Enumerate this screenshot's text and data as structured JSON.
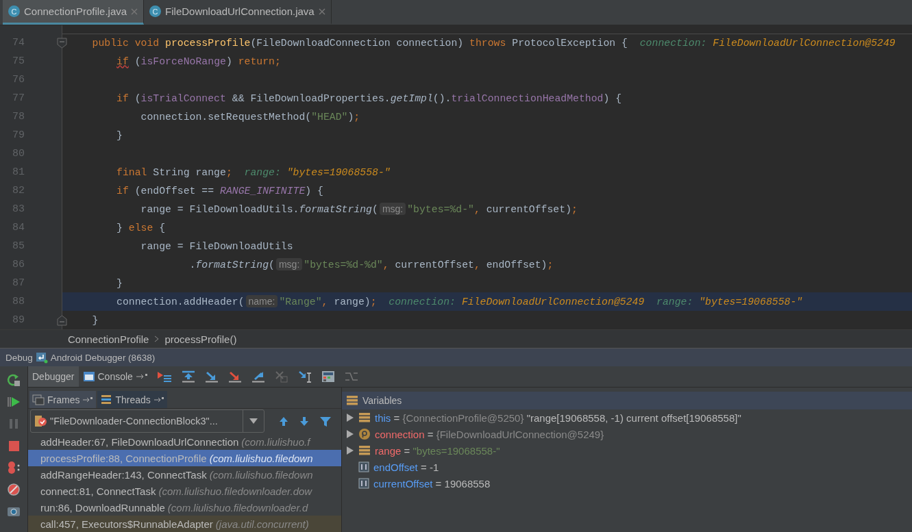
{
  "editor_tabs": [
    {
      "icon_letter": "C",
      "label": "ConnectionProfile.java",
      "selected": true
    },
    {
      "icon_letter": "C",
      "label": "FileDownloadUrlConnection.java",
      "selected": false
    }
  ],
  "code": {
    "lines": [
      {
        "number": "74",
        "fold_open": true,
        "current": false,
        "tokens": [
          {
            "kind": "keyword",
            "text": "    public "
          },
          {
            "kind": "keyword",
            "text": "void "
          },
          {
            "kind": "method",
            "text": "processProfile"
          },
          {
            "kind": "plain",
            "text": "(FileDownloadConnection connection) "
          },
          {
            "kind": "keyword",
            "text": "throws "
          },
          {
            "kind": "plain",
            "text": "ProtocolException {"
          },
          {
            "kind": "debug_name",
            "text": "  connection: "
          },
          {
            "kind": "debug_value",
            "text": "FileDownloadUrlConnection@5249"
          }
        ]
      },
      {
        "number": "75",
        "current": false,
        "tokens": [
          {
            "kind": "keyword_warn",
            "text": "        if"
          },
          {
            "kind": "plain",
            "text": " ("
          },
          {
            "kind": "field",
            "text": "isForceNoRange"
          },
          {
            "kind": "plain",
            "text": ") "
          },
          {
            "kind": "keyword",
            "text": "return;"
          }
        ]
      },
      {
        "number": "76",
        "current": false
      },
      {
        "number": "77",
        "current": false,
        "tokens": [
          {
            "kind": "keyword",
            "text": "        if"
          },
          {
            "kind": "plain",
            "text": " ("
          },
          {
            "kind": "field",
            "text": "isTrialConnect"
          },
          {
            "kind": "plain",
            "text": " && FileDownloadProperties."
          },
          {
            "kind": "static",
            "text": "getImpl"
          },
          {
            "kind": "plain",
            "text": "()."
          },
          {
            "kind": "field",
            "text": "trialConnectionHeadMethod"
          },
          {
            "kind": "plain",
            "text": ") {"
          }
        ]
      },
      {
        "number": "78",
        "current": false,
        "tokens": [
          {
            "kind": "plain",
            "text": "            connection.setRequestMethod("
          },
          {
            "kind": "string",
            "text": "\"HEAD\""
          },
          {
            "kind": "plain",
            "text": ")"
          },
          {
            "kind": "keyword",
            "text": ";"
          }
        ]
      },
      {
        "number": "79",
        "current": false,
        "tokens": [
          {
            "kind": "plain",
            "text": "        }"
          }
        ]
      },
      {
        "number": "80",
        "current": false
      },
      {
        "number": "81",
        "current": false,
        "tokens": [
          {
            "kind": "keyword",
            "text": "        final "
          },
          {
            "kind": "plain",
            "text": "String range"
          },
          {
            "kind": "keyword",
            "text": ";"
          },
          {
            "kind": "debug_name",
            "text": "  range: "
          },
          {
            "kind": "debug_value",
            "text": "\"bytes=19068558-\""
          }
        ]
      },
      {
        "number": "82",
        "current": false,
        "tokens": [
          {
            "kind": "keyword",
            "text": "        if"
          },
          {
            "kind": "plain",
            "text": " (endOffset == "
          },
          {
            "kind": "constant",
            "text": "RANGE_INFINITE"
          },
          {
            "kind": "plain",
            "text": ") {"
          }
        ]
      },
      {
        "number": "83",
        "current": false,
        "tokens": [
          {
            "kind": "plain",
            "text": "            range = FileDownloadUtils."
          },
          {
            "kind": "static",
            "text": "formatString"
          },
          {
            "kind": "plain",
            "text": "("
          },
          {
            "kind": "param_hint",
            "text": "msg:"
          },
          {
            "kind": "string",
            "text": "\"bytes=%d-\""
          },
          {
            "kind": "keyword",
            "text": ","
          },
          {
            "kind": "plain",
            "text": " currentOffset)"
          },
          {
            "kind": "keyword",
            "text": ";"
          }
        ]
      },
      {
        "number": "84",
        "current": false,
        "tokens": [
          {
            "kind": "plain",
            "text": "        } "
          },
          {
            "kind": "keyword",
            "text": "else "
          },
          {
            "kind": "plain",
            "text": "{"
          }
        ]
      },
      {
        "number": "85",
        "current": false,
        "tokens": [
          {
            "kind": "plain",
            "text": "            range = FileDownloadUtils"
          }
        ]
      },
      {
        "number": "86",
        "current": false,
        "tokens": [
          {
            "kind": "plain",
            "text": "                    ."
          },
          {
            "kind": "static",
            "text": "formatString"
          },
          {
            "kind": "plain",
            "text": "("
          },
          {
            "kind": "param_hint",
            "text": "msg:"
          },
          {
            "kind": "string",
            "text": "\"bytes=%d-%d\""
          },
          {
            "kind": "keyword",
            "text": ","
          },
          {
            "kind": "plain",
            "text": " currentOffset"
          },
          {
            "kind": "keyword",
            "text": ","
          },
          {
            "kind": "plain",
            "text": " endOffset)"
          },
          {
            "kind": "keyword",
            "text": ";"
          }
        ]
      },
      {
        "number": "87",
        "current": false,
        "tokens": [
          {
            "kind": "plain",
            "text": "        }"
          }
        ]
      },
      {
        "number": "88",
        "current": true,
        "tokens": [
          {
            "kind": "plain",
            "text": "        connection.addHeader("
          },
          {
            "kind": "param_hint",
            "text": "name:"
          },
          {
            "kind": "string",
            "text": "\"Range\""
          },
          {
            "kind": "keyword",
            "text": ","
          },
          {
            "kind": "plain",
            "text": " range)"
          },
          {
            "kind": "keyword",
            "text": ";"
          },
          {
            "kind": "debug_name",
            "text": "  connection: "
          },
          {
            "kind": "debug_value",
            "text": "FileDownloadUrlConnection@5249"
          },
          {
            "kind": "debug_name",
            "text": "  range: "
          },
          {
            "kind": "debug_value",
            "text": "\"bytes=19068558-\""
          }
        ]
      },
      {
        "number": "89",
        "fold_close": true,
        "current": false,
        "tokens": [
          {
            "kind": "plain",
            "text": "    }"
          }
        ]
      }
    ]
  },
  "breadcrumb": [
    "ConnectionProfile",
    "processProfile()"
  ],
  "debug": {
    "title": "Debug",
    "session": "Android Debugger (8638)",
    "tabs": [
      {
        "label": "Debugger",
        "selected": true,
        "pinnable": false
      },
      {
        "label": "Console",
        "selected": false,
        "pinnable": true
      }
    ],
    "frames_panel": {
      "tabs": [
        {
          "label": "Frames",
          "selected": true
        },
        {
          "label": "Threads",
          "selected": false
        }
      ],
      "thread": "\"FileDownloader-ConnectionBlock3\"...",
      "frames": [
        {
          "method": "addHeader:67, FileDownloadUrlConnection",
          "package": "(com.liulishuo.f",
          "selected": false,
          "library": false
        },
        {
          "method": "processProfile:88, ConnectionProfile",
          "package": "(com.liulishuo.filedown",
          "selected": true,
          "library": false
        },
        {
          "method": "addRangeHeader:143, ConnectTask",
          "package": "(com.liulishuo.filedown",
          "selected": false,
          "library": false
        },
        {
          "method": "connect:81, ConnectTask",
          "package": "(com.liulishuo.filedownloader.dow",
          "selected": false,
          "library": false
        },
        {
          "method": "run:86, DownloadRunnable",
          "package": "(com.liulishuo.filedownloader.d",
          "selected": false,
          "library": false
        },
        {
          "method": "call:457, Executors$RunnableAdapter",
          "package": "(java.util.concurrent)",
          "selected": false,
          "library": true
        }
      ]
    },
    "variables": {
      "title": "Variables",
      "items": [
        {
          "kind": "object",
          "expandable": true,
          "highlighted": false,
          "name": "this",
          "value": [
            {
              "kind": "op",
              "text": "="
            },
            {
              "kind": "ref",
              "text": "{ConnectionProfile@5250}"
            },
            {
              "kind": "plain",
              "text": "\"range[19068558, -1) current offset[19068558]\""
            }
          ]
        },
        {
          "kind": "param",
          "expandable": true,
          "highlighted": true,
          "name": "connection",
          "value": [
            {
              "kind": "op",
              "text": "="
            },
            {
              "kind": "ref",
              "text": "{FileDownloadUrlConnection@5249}"
            }
          ]
        },
        {
          "kind": "object",
          "expandable": true,
          "highlighted": true,
          "name": "range",
          "value": [
            {
              "kind": "op",
              "text": "="
            },
            {
              "kind": "string",
              "text": "\"bytes=19068558-\""
            }
          ]
        },
        {
          "kind": "primitive",
          "expandable": false,
          "highlighted": false,
          "name": "endOffset",
          "value": [
            {
              "kind": "op",
              "text": "="
            },
            {
              "kind": "plain",
              "text": "-1"
            }
          ]
        },
        {
          "kind": "primitive",
          "expandable": false,
          "highlighted": false,
          "name": "currentOffset",
          "value": [
            {
              "kind": "op",
              "text": "="
            },
            {
              "kind": "plain",
              "text": "19068558"
            }
          ]
        }
      ]
    }
  }
}
